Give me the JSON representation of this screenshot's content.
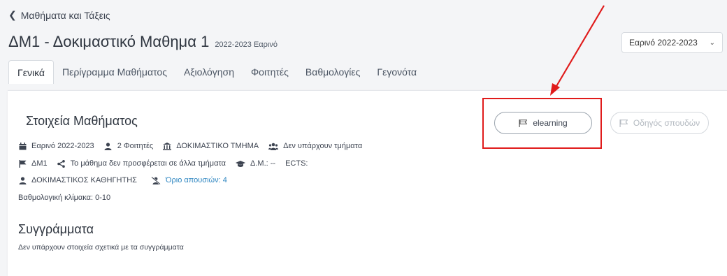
{
  "nav": {
    "back_label": "Μαθήματα και Τάξεις"
  },
  "header": {
    "title": "ΔΜ1 - Δοκιμαστικό Μαθημα 1",
    "subtitle": "2022-2023 Εαρινό",
    "term_select": "Εαρινό 2022-2023"
  },
  "tabs": [
    {
      "label": "Γενικά",
      "active": true
    },
    {
      "label": "Περίγραμμα Μαθήματος",
      "active": false
    },
    {
      "label": "Αξιολόγηση",
      "active": false
    },
    {
      "label": "Φοιτητές",
      "active": false
    },
    {
      "label": "Βαθμολογίες",
      "active": false
    },
    {
      "label": "Γεγονότα",
      "active": false
    }
  ],
  "course_info": {
    "title": "Στοιχεία Μαθήματος",
    "period": "Εαρινό 2022-2023",
    "students": "2 Φοιτητές",
    "department": "ΔΟΚΙΜΑΣΤΙΚΟ ΤΜΗΜΑ",
    "groups": "Δεν υπάρχουν τμήματα",
    "code": "ΔΜ1",
    "shared": "Το μάθημα δεν προσφέρεται σε άλλα τμήματα",
    "dm": "Δ.Μ.: --",
    "ects": "ECTS:",
    "instructor": "ΔΟΚΙΜΑΣΤΙΚΟΣ ΚΑΘΗΓΗΤΗΣ",
    "absence_limit": "Όριο απουσιών: 4",
    "grade_scale": "Βαθμολογική κλίμακα: 0-10"
  },
  "buttons": {
    "elearning": "elearning",
    "study_guide": "Οδηγός σπουδών"
  },
  "books": {
    "title": "Συγγράμματα",
    "empty_text": "Δεν υπάρχουν στοιχεία σχετικά με τα συγγράμματα"
  },
  "colors": {
    "accent_link": "#2e86c1",
    "annotation": "#e01b1b"
  },
  "icons": [
    "chevron-left-icon",
    "chevron-down-icon",
    "calendar-icon",
    "user-icon",
    "building-icon",
    "users-icon",
    "flag-icon",
    "share-icon",
    "graduation-cap-icon",
    "user-slash-icon"
  ]
}
